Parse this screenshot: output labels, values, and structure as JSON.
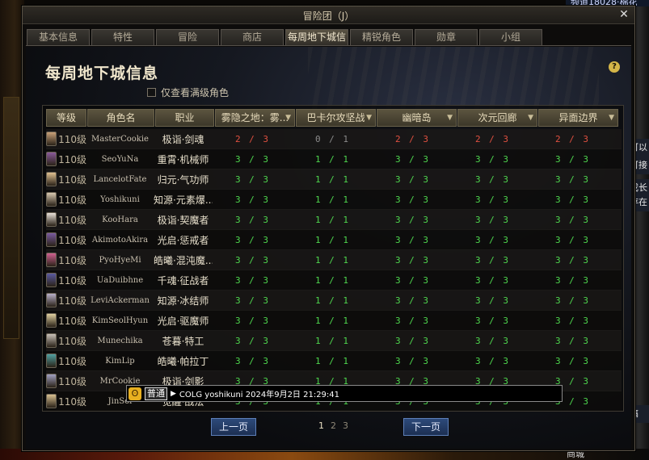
{
  "background": {
    "top_right_text": "频道18028·棉花",
    "side_fragments": [
      "可以",
      "可接",
      "成长",
      "存在",
      "搞"
    ],
    "bottom_text": "商城"
  },
  "window": {
    "title": "冒险团（J）",
    "close_icon": "close-icon"
  },
  "tabs": [
    {
      "label": "基本信息",
      "active": false
    },
    {
      "label": "特性",
      "active": false
    },
    {
      "label": "冒险",
      "active": false
    },
    {
      "label": "商店",
      "active": false
    },
    {
      "label": "每周地下城信息",
      "active": true
    },
    {
      "label": "精锐角色",
      "active": false
    },
    {
      "label": "勋章",
      "active": false
    },
    {
      "label": "小组",
      "active": false
    }
  ],
  "panel": {
    "title": "每周地下城信息",
    "help_icon": "?",
    "filter_label": "仅查看满级角色",
    "filter_checked": false
  },
  "table": {
    "headers": [
      "等级",
      "角色名",
      "职业",
      "雾隐之地：雾...",
      "巴卡尔攻坚战",
      "幽暗岛",
      "次元回廊",
      "异面边界"
    ],
    "rows": [
      {
        "level": "110级",
        "name": "MasterCookie",
        "job": "极诣·剑魂",
        "d": [
          "2 / 3",
          "0 / 1",
          "2 / 3",
          "2 / 3",
          "2 / 3"
        ],
        "avatar": "#c9a078"
      },
      {
        "level": "110级",
        "name": "SeoYuNa",
        "job": "重霄·机械师",
        "d": [
          "3 / 3",
          "1 / 1",
          "3 / 3",
          "3 / 3",
          "3 / 3"
        ],
        "avatar": "#8a5a9a"
      },
      {
        "level": "110级",
        "name": "LancelotFate",
        "job": "归元·气功师",
        "d": [
          "3 / 3",
          "1 / 1",
          "3 / 3",
          "3 / 3",
          "3 / 3"
        ],
        "avatar": "#e0c090"
      },
      {
        "level": "110级",
        "name": "Yoshikuni",
        "job": "知源·元素爆...",
        "d": [
          "3 / 3",
          "1 / 1",
          "3 / 3",
          "3 / 3",
          "3 / 3"
        ],
        "avatar": "#d8c8b0"
      },
      {
        "level": "110级",
        "name": "KooHara",
        "job": "极诣·契魔者",
        "d": [
          "3 / 3",
          "1 / 1",
          "3 / 3",
          "3 / 3",
          "3 / 3"
        ],
        "avatar": "#e8e0d8"
      },
      {
        "level": "110级",
        "name": "AkimotoAkira",
        "job": "光启·惩戒者",
        "d": [
          "3 / 3",
          "1 / 1",
          "3 / 3",
          "3 / 3",
          "3 / 3"
        ],
        "avatar": "#7a5aa0"
      },
      {
        "level": "110级",
        "name": "PyoHyeMi",
        "job": "皓曦·混沌魔...",
        "d": [
          "3 / 3",
          "1 / 1",
          "3 / 3",
          "3 / 3",
          "3 / 3"
        ],
        "avatar": "#d06090"
      },
      {
        "level": "110级",
        "name": "UaDuibhne",
        "job": "千魂·征战者",
        "d": [
          "3 / 3",
          "1 / 1",
          "3 / 3",
          "3 / 3",
          "3 / 3"
        ],
        "avatar": "#5a5aa0"
      },
      {
        "level": "110级",
        "name": "LeviAckerman",
        "job": "知源·冰结师",
        "d": [
          "3 / 3",
          "1 / 1",
          "3 / 3",
          "3 / 3",
          "3 / 3"
        ],
        "avatar": "#b8b0c8"
      },
      {
        "level": "110级",
        "name": "KimSeolHyun",
        "job": "光启·驱魔师",
        "d": [
          "3 / 3",
          "1 / 1",
          "3 / 3",
          "3 / 3",
          "3 / 3"
        ],
        "avatar": "#e0d0a0"
      },
      {
        "level": "110级",
        "name": "Munechika",
        "job": "苍暮·特工",
        "d": [
          "3 / 3",
          "1 / 1",
          "3 / 3",
          "3 / 3",
          "3 / 3"
        ],
        "avatar": "#c8c0b8"
      },
      {
        "level": "110级",
        "name": "KimLip",
        "job": "皓曦·帕拉丁",
        "d": [
          "3 / 3",
          "1 / 1",
          "3 / 3",
          "3 / 3",
          "3 / 3"
        ],
        "avatar": "#50a0a0"
      },
      {
        "level": "110级",
        "name": "MrCookie",
        "job": "极诣·剑影",
        "d": [
          "3 / 3",
          "1 / 1",
          "3 / 3",
          "3 / 3",
          "3 / 3"
        ],
        "avatar": "#a0a0c0"
      },
      {
        "level": "110级",
        "name": "JinSol",
        "job": "觉醒·战法",
        "d": [
          "3 / 3",
          "1 / 1",
          "3 / 3",
          "3 / 3",
          "3 / 3"
        ],
        "avatar": "#d8c090"
      }
    ]
  },
  "tooltip": {
    "badge": "普通",
    "text": "COLG yoshikuni 2024年9月2日 21:29:41"
  },
  "pager": {
    "prev_label": "上一页",
    "next_label": "下一页",
    "pages": [
      "1",
      "2",
      "3"
    ],
    "current": "1"
  },
  "colors": {
    "full": "#4ed64e",
    "partial": "#e05040",
    "zero": "#8b8b8b"
  }
}
